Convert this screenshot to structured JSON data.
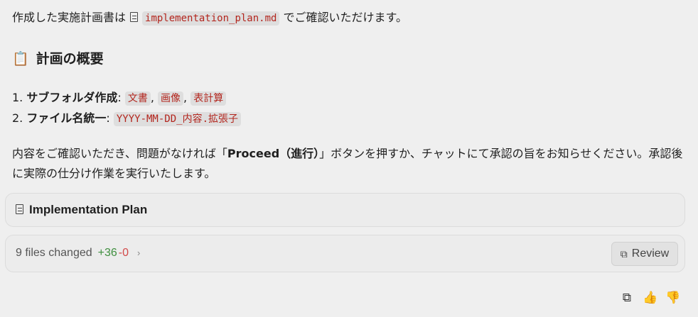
{
  "intro": {
    "prefix": "作成した実施計画書は",
    "file_name": "implementation_plan.md",
    "suffix": "でご確認いただけます。"
  },
  "heading": {
    "icon": "clipboard-icon",
    "text": "計画の概要"
  },
  "list": [
    {
      "number": "1.",
      "title": "サブフォルダ作成",
      "colon": ":",
      "codes": [
        "文書",
        "画像",
        "表計算"
      ]
    },
    {
      "number": "2.",
      "title": "ファイル名統一",
      "colon": ":",
      "code": "YYYY-MM-DD_内容.拡張子"
    }
  ],
  "paragraph": {
    "before": "内容をご確認いただき、問題がなければ「",
    "bold": "Proceed（進行）",
    "after": "」ボタンを押すか、チャットにて承認の旨をお知らせください。承認後に実際の仕分け作業を実行いたします。"
  },
  "plan_card": {
    "label": "Implementation Plan"
  },
  "changes_card": {
    "files_changed": "9 files changed",
    "added": "+36",
    "removed": "-0",
    "review_label": "Review"
  },
  "colors": {
    "code_text": "#b3261e",
    "added": "#3f8f3f",
    "removed": "#d24a4a"
  }
}
